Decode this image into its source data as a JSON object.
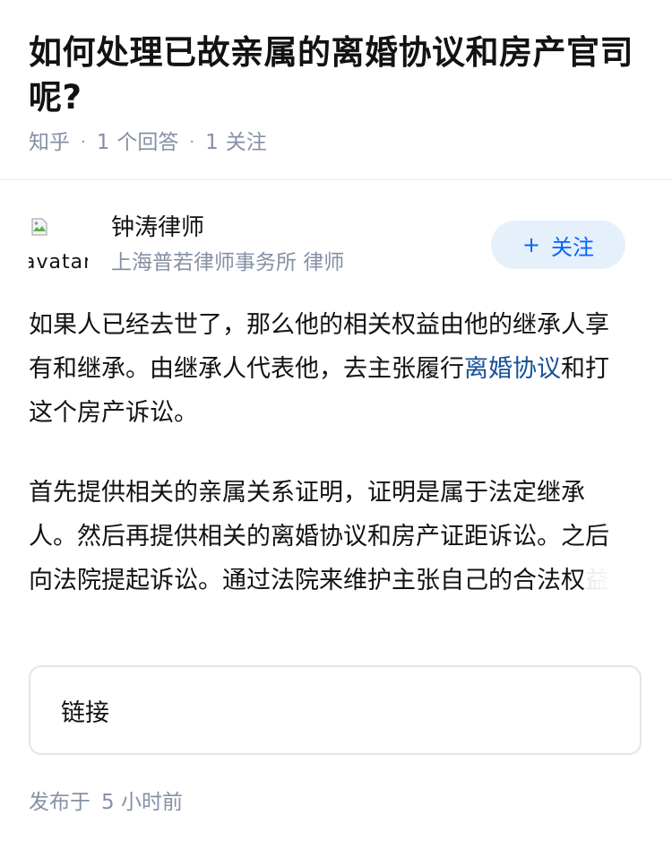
{
  "question": {
    "title": "如何处理已故亲属的离婚协议和房产官司呢?",
    "source": "知乎",
    "answer_count": "1",
    "answer_label": "个回答",
    "follow_count": "1",
    "follow_label": "关注"
  },
  "author": {
    "avatar_alt": "avatar",
    "name": "钟涛律师",
    "bio": "上海普若律师事务所 律师",
    "follow_button": {
      "icon": "plus-icon",
      "icon_glyph": "+",
      "label": "关注"
    }
  },
  "answer": {
    "paragraph1_before_link": "如果人已经去世了，那么他的相关权益由他的继承人享有和继承。由继承人代表他，去主张履行",
    "paragraph1_link": "离婚协议",
    "paragraph1_after_link": "和打这个房产诉讼。",
    "paragraph2_visible": "首先提供相关的亲属关系证明，证明是属于法定继承人。然后再提供相关的离婚协议和房产证距诉讼。之后向法院提起诉讼。通过法院来维护主张自己的合法权",
    "paragraph2_faded": "益"
  },
  "link_card": {
    "label": "链接"
  },
  "footer": {
    "published_prefix": "发布于",
    "published_time": "5 小时前"
  },
  "colors": {
    "text": "#121212",
    "muted": "#8590a6",
    "link": "#175199",
    "accent": "#0066ff",
    "follow_bg": "#e6f0fb",
    "border": "#e5e5e5"
  }
}
